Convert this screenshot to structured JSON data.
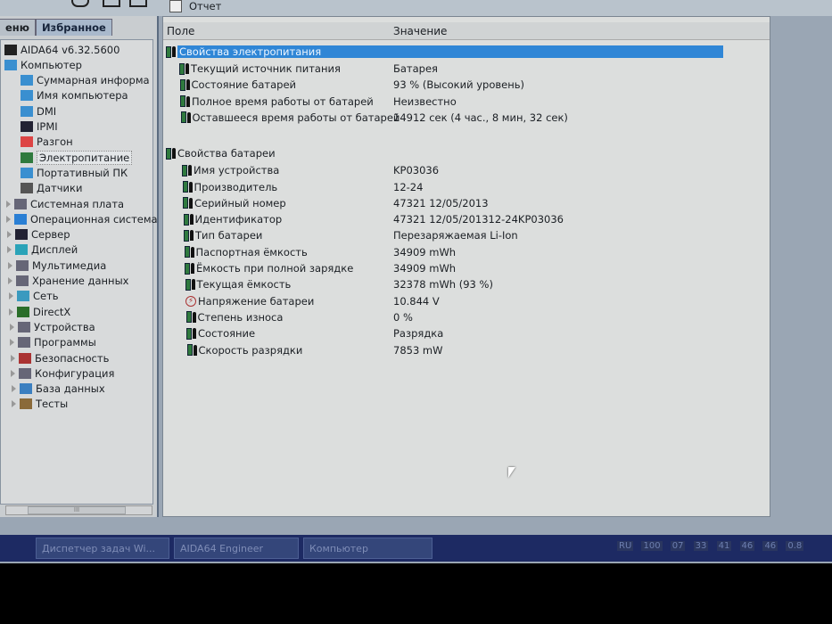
{
  "toolbar": {
    "report_label": "Отчет"
  },
  "left_panel": {
    "tabs": [
      {
        "label": "еню"
      },
      {
        "label": "Избранное"
      }
    ],
    "tree": [
      {
        "label": "AIDA64 v6.32.5600",
        "level": 0,
        "icon": "aida-icon"
      },
      {
        "label": "Компьютер",
        "level": 0,
        "icon": "monitor-icon"
      },
      {
        "label": "Суммарная информа",
        "level": 1,
        "icon": "monitor-icon"
      },
      {
        "label": "Имя компьютера",
        "level": 1,
        "icon": "monitor-icon"
      },
      {
        "label": "DMI",
        "level": 1,
        "icon": "monitor-icon"
      },
      {
        "label": "IPMI",
        "level": 1,
        "icon": "server-icon"
      },
      {
        "label": "Разгон",
        "level": 1,
        "icon": "flame-icon"
      },
      {
        "label": "Электропитание",
        "level": 1,
        "icon": "battery-plug-icon",
        "selected": true
      },
      {
        "label": "Портативный ПК",
        "level": 1,
        "icon": "laptop-icon"
      },
      {
        "label": "Датчики",
        "level": 1,
        "icon": "gauge-icon"
      },
      {
        "label": "Системная плата",
        "level": 0,
        "icon": "motherboard-icon",
        "expandable": true
      },
      {
        "label": "Операционная система",
        "level": 0,
        "icon": "windows-icon",
        "expandable": true
      },
      {
        "label": "Сервер",
        "level": 0,
        "icon": "server-icon",
        "expandable": true
      },
      {
        "label": "Дисплей",
        "level": 0,
        "icon": "display-icon",
        "expandable": true
      },
      {
        "label": "Мультимедиа",
        "level": 0,
        "icon": "speaker-icon",
        "expandable": true
      },
      {
        "label": "Хранение данных",
        "level": 0,
        "icon": "storage-icon",
        "expandable": true
      },
      {
        "label": "Сеть",
        "level": 0,
        "icon": "network-icon",
        "expandable": true
      },
      {
        "label": "DirectX",
        "level": 0,
        "icon": "xbox-icon",
        "expandable": true
      },
      {
        "label": "Устройства",
        "level": 0,
        "icon": "device-icon",
        "expandable": true
      },
      {
        "label": "Программы",
        "level": 0,
        "icon": "programs-icon",
        "expandable": true
      },
      {
        "label": "Безопасность",
        "level": 0,
        "icon": "shield-icon",
        "expandable": true
      },
      {
        "label": "Конфигурация",
        "level": 0,
        "icon": "config-icon",
        "expandable": true
      },
      {
        "label": "База данных",
        "level": 0,
        "icon": "database-icon",
        "expandable": true
      },
      {
        "label": "Тесты",
        "level": 0,
        "icon": "tests-icon",
        "expandable": true
      }
    ],
    "scrollbar_label": "III"
  },
  "report": {
    "columns": {
      "field": "Поле",
      "value": "Значение"
    },
    "groups": [
      {
        "title": "Свойства электропитания",
        "selected": true,
        "rows": [
          {
            "field": "Текущий источник питания",
            "value": "Батарея"
          },
          {
            "field": "Состояние батарей",
            "value": "93 % (Высокий уровень)"
          },
          {
            "field": "Полное время работы от батарей",
            "value": "Неизвестно"
          },
          {
            "field": "Оставшееся время работы от батарей",
            "value": "14912 сек (4 час., 8 мин, 32 сек)"
          }
        ]
      },
      {
        "title": "Свойства батареи",
        "rows": [
          {
            "field": "Имя устройства",
            "value": "KP03036"
          },
          {
            "field": "Производитель",
            "value": "12-24"
          },
          {
            "field": "Серийный номер",
            "value": "47321 12/05/2013"
          },
          {
            "field": "Идентификатор",
            "value": "47321 12/05/201312-24KP03036"
          },
          {
            "field": "Тип батареи",
            "value": "Перезаряжаемая Li-Ion"
          },
          {
            "field": "Паспортная ёмкость",
            "value": "34909 mWh"
          },
          {
            "field": "Ёмкость при полной зарядке",
            "value": "34909 mWh"
          },
          {
            "field": "Текущая ёмкость",
            "value": "32378 mWh  (93 %)"
          },
          {
            "field": "Напряжение батареи",
            "value": "10.844 V",
            "icon": "voltage-icon"
          },
          {
            "field": "Степень износа",
            "value": "0 %"
          },
          {
            "field": "Состояние",
            "value": "Разрядка"
          },
          {
            "field": "Скорость разрядки",
            "value": "7853 mW"
          }
        ]
      }
    ]
  },
  "taskbar": {
    "items": [
      {
        "label": "Диспетчер задач Wi..."
      },
      {
        "label": "AIDA64 Engineer"
      },
      {
        "label": "Компьютер"
      }
    ],
    "tray": {
      "lang": "RU",
      "values": [
        "100",
        "07",
        "33",
        "41",
        "46",
        "46",
        "0.8"
      ]
    }
  },
  "colors": {
    "selection": "#2f86d6",
    "taskbar": "#1d2a63",
    "battery": "#2f7a3e"
  }
}
